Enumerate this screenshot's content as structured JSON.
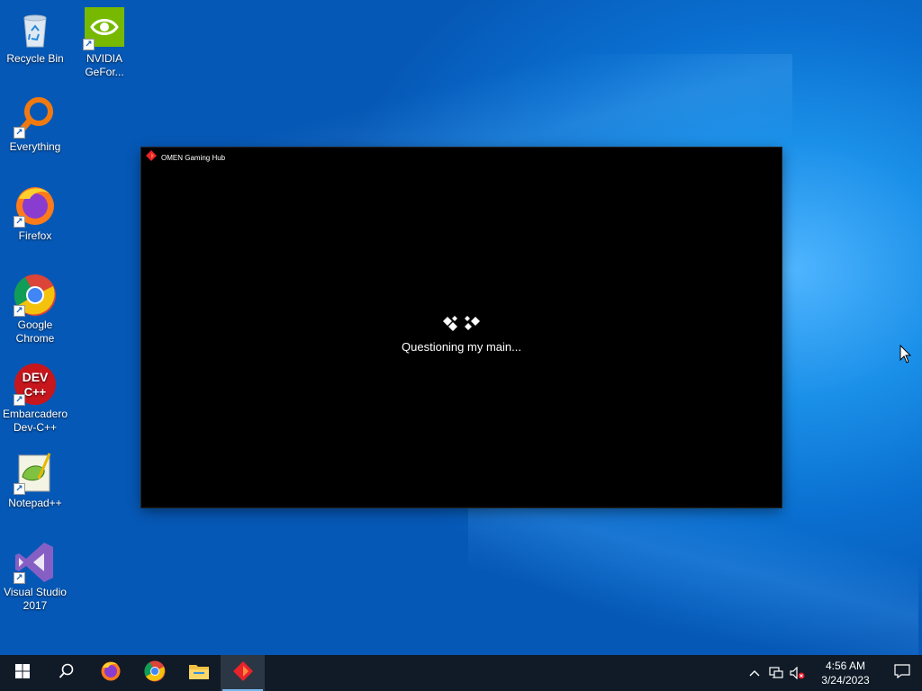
{
  "desktop": {
    "icons": [
      {
        "label": "Recycle Bin",
        "icon": "recycle-bin-icon"
      },
      {
        "label": "NVIDIA GeFor...",
        "icon": "nvidia-icon"
      },
      {
        "label": "Everything",
        "icon": "everything-icon"
      },
      {
        "label": "Firefox",
        "icon": "firefox-icon"
      },
      {
        "label": "Google Chrome",
        "icon": "chrome-icon"
      },
      {
        "label": "Embarcadero Dev-C++",
        "icon": "devcpp-icon"
      },
      {
        "label": "Notepad++",
        "icon": "notepadpp-icon"
      },
      {
        "label": "Visual Studio 2017",
        "icon": "visual-studio-icon"
      }
    ]
  },
  "app_window": {
    "title": "OMEN Gaming Hub",
    "loading_text": "Questioning my main...",
    "background": "#000000",
    "accent": "#e8232a"
  },
  "taskbar": {
    "background": "#101b27",
    "buttons": [
      {
        "name": "start",
        "icon": "windows-logo-icon"
      },
      {
        "name": "search",
        "icon": "search-icon"
      },
      {
        "name": "firefox",
        "icon": "firefox-icon"
      },
      {
        "name": "chrome",
        "icon": "chrome-icon"
      },
      {
        "name": "file-explorer",
        "icon": "folder-icon"
      },
      {
        "name": "omen-gaming-hub",
        "icon": "omen-icon",
        "active": true
      }
    ],
    "tray": {
      "icons": [
        "chevron-up-icon",
        "network-icon",
        "volume-muted-icon"
      ],
      "time": "4:56 AM",
      "date": "3/24/2023",
      "notification_icon": "action-center-icon"
    }
  }
}
